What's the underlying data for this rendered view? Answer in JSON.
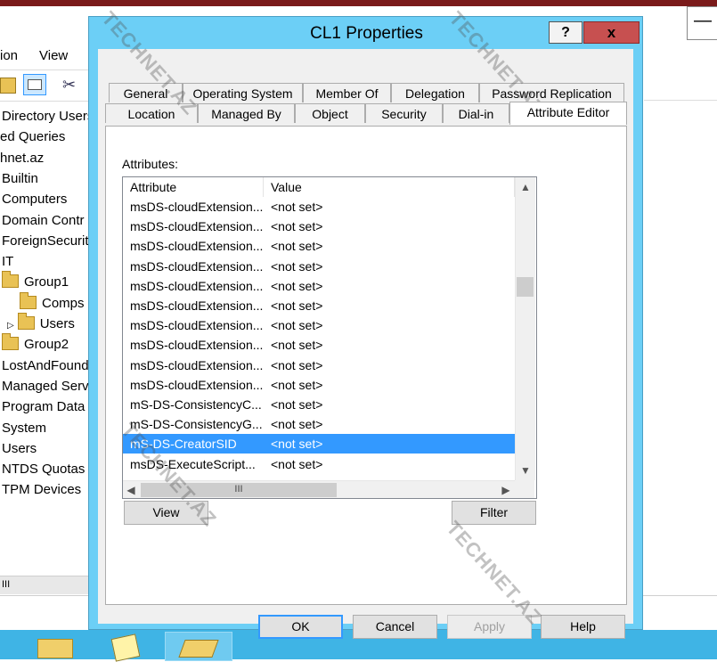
{
  "dialog": {
    "title": "CL1 Properties",
    "help_glyph": "?",
    "close_glyph": "x"
  },
  "tabs_row1": [
    "General",
    "Operating System",
    "Member Of",
    "Delegation",
    "Password Replication"
  ],
  "tabs_row2": [
    "Location",
    "Managed By",
    "Object",
    "Security",
    "Dial-in",
    "Attribute Editor"
  ],
  "selected_tab": "Attribute Editor",
  "attributes": {
    "label": "Attributes:",
    "columns": [
      "Attribute",
      "Value"
    ],
    "rows": [
      {
        "attribute": "msDS-cloudExtension...",
        "value": "<not set>"
      },
      {
        "attribute": "msDS-cloudExtension...",
        "value": "<not set>"
      },
      {
        "attribute": "msDS-cloudExtension...",
        "value": "<not set>"
      },
      {
        "attribute": "msDS-cloudExtension...",
        "value": "<not set>"
      },
      {
        "attribute": "msDS-cloudExtension...",
        "value": "<not set>"
      },
      {
        "attribute": "msDS-cloudExtension...",
        "value": "<not set>"
      },
      {
        "attribute": "msDS-cloudExtension...",
        "value": "<not set>"
      },
      {
        "attribute": "msDS-cloudExtension...",
        "value": "<not set>"
      },
      {
        "attribute": "msDS-cloudExtension...",
        "value": "<not set>"
      },
      {
        "attribute": "msDS-cloudExtension...",
        "value": "<not set>"
      },
      {
        "attribute": "mS-DS-ConsistencyC...",
        "value": "<not set>"
      },
      {
        "attribute": "mS-DS-ConsistencyG...",
        "value": "<not set>"
      },
      {
        "attribute": "mS-DS-CreatorSID",
        "value": "<not set>",
        "selected": true
      },
      {
        "attribute": "msDS-ExecuteScript...",
        "value": "<not set>"
      }
    ],
    "hscroll_thumb_glyph": "III"
  },
  "buttons": {
    "view": "View",
    "filter": "Filter",
    "ok": "OK",
    "cancel": "Cancel",
    "apply": "Apply",
    "help": "Help"
  },
  "background_app": {
    "menu": [
      "ion",
      "View"
    ],
    "minimize_glyph": "—",
    "tree": [
      {
        "label": "Directory Users",
        "folder": false
      },
      {
        "label": "ed Queries",
        "folder": false
      },
      {
        "label": "hnet.az",
        "folder": false
      },
      {
        "label": "Builtin",
        "folder": false
      },
      {
        "label": "Computers",
        "folder": false
      },
      {
        "label": "Domain Contr",
        "folder": false
      },
      {
        "label": "ForeignSecurit",
        "folder": false
      },
      {
        "label": "IT",
        "folder": false
      },
      {
        "label": "Group1",
        "folder": true
      },
      {
        "label": "Comps",
        "folder": true
      },
      {
        "label": "Users",
        "folder": true
      },
      {
        "label": "Group2",
        "folder": true
      },
      {
        "label": "LostAndFound",
        "folder": false
      },
      {
        "label": "Managed Serv",
        "folder": false
      },
      {
        "label": "Program Data",
        "folder": false
      },
      {
        "label": "System",
        "folder": false
      },
      {
        "label": "Users",
        "folder": false
      },
      {
        "label": "NTDS Quotas",
        "folder": false
      },
      {
        "label": "TPM Devices",
        "folder": false
      }
    ],
    "scroll_glyph": "III"
  },
  "watermark": "TECHNET.AZ",
  "colors": {
    "dialog_frame": "#6ccff6",
    "close_button": "#c75050",
    "selection": "#3399ff",
    "taskbar": "#3fb4e5"
  }
}
